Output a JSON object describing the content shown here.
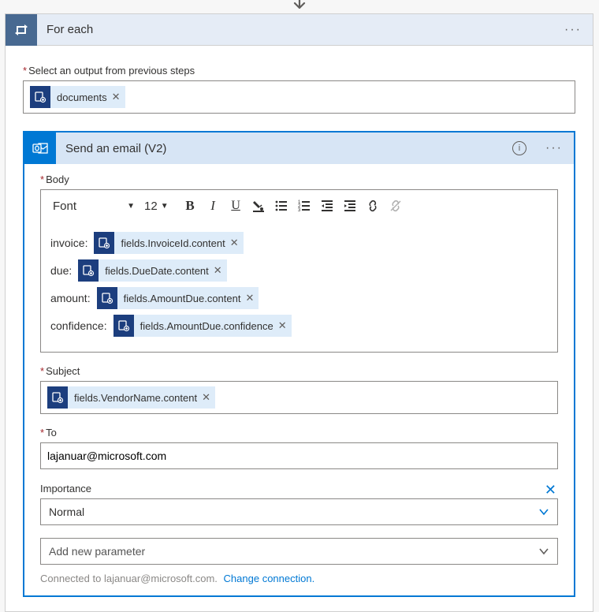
{
  "foreach": {
    "title": "For each",
    "output_label": "Select an output from previous steps",
    "token": "documents"
  },
  "email": {
    "title": "Send an email (V2)",
    "body_label": "Body",
    "font_label": "Font",
    "font_size": "12",
    "rows": {
      "invoice": {
        "label": "invoice:",
        "token": "fields.InvoiceId.content"
      },
      "due": {
        "label": "due:",
        "token": "fields.DueDate.content"
      },
      "amount": {
        "label": "amount:",
        "token": "fields.AmountDue.content"
      },
      "confidence": {
        "label": "confidence:",
        "token": "fields.AmountDue.confidence"
      }
    },
    "subject_label": "Subject",
    "subject_token": "fields.VendorName.content",
    "to_label": "To",
    "to_value": "lajanuar@microsoft.com",
    "importance_label": "Importance",
    "importance_value": "Normal",
    "add_param_placeholder": "Add new parameter",
    "connected_text": "Connected to lajanuar@microsoft.com.",
    "change_link": "Change connection."
  }
}
